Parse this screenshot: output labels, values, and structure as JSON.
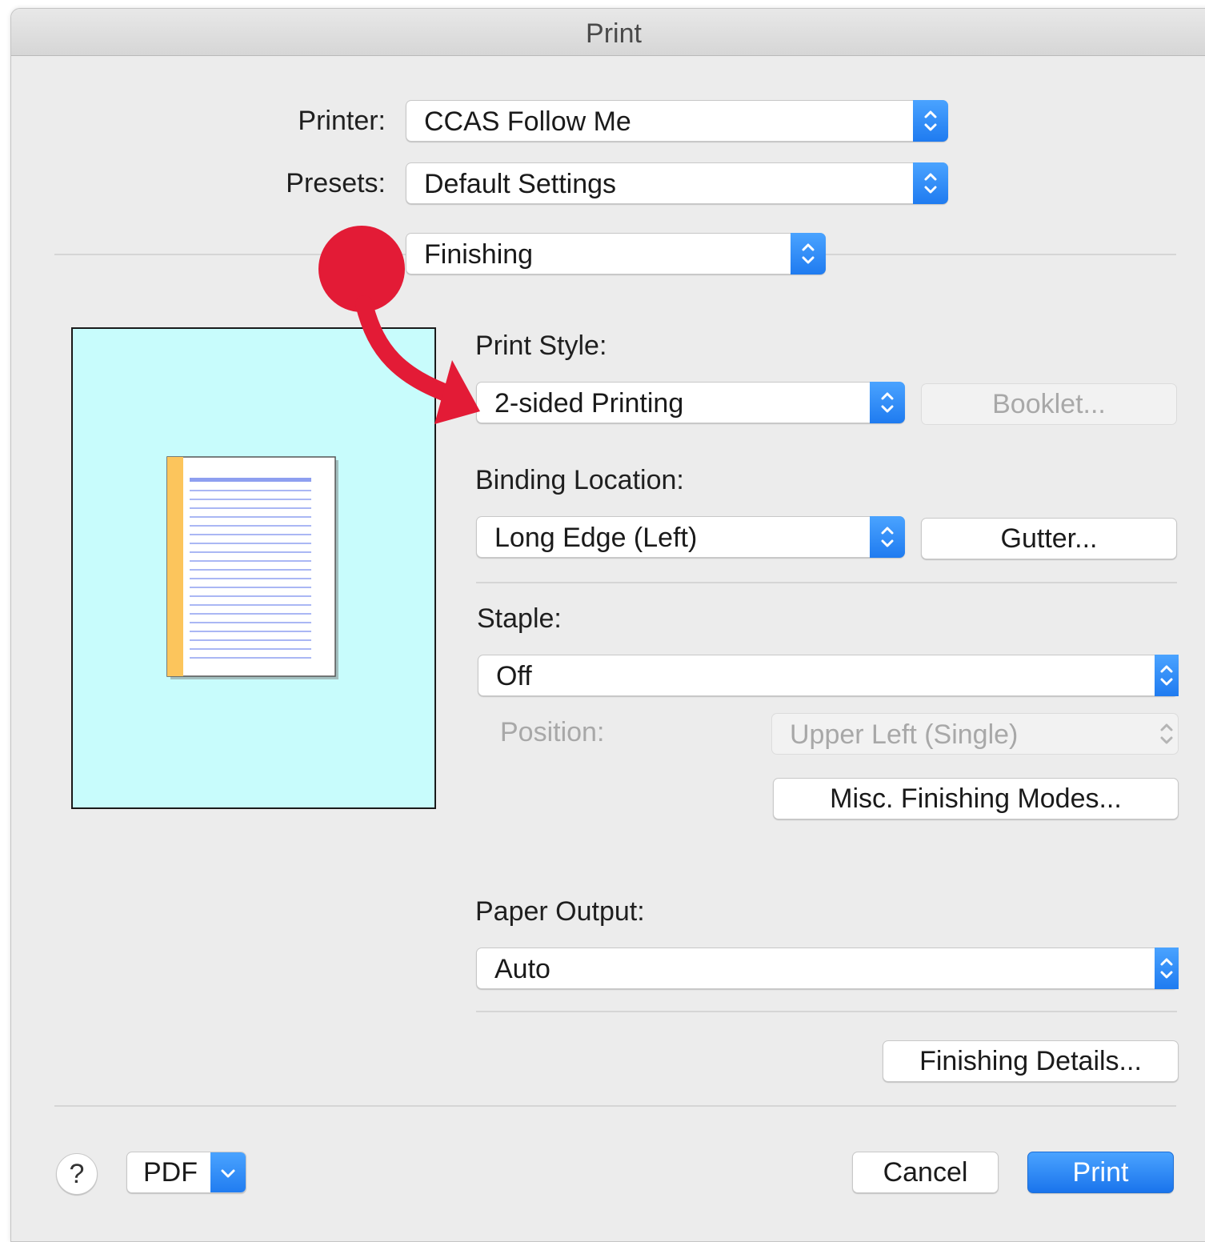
{
  "window": {
    "title": "Print"
  },
  "printer": {
    "label": "Printer:",
    "value": "CCAS Follow Me"
  },
  "presets": {
    "label": "Presets:",
    "value": "Default Settings"
  },
  "panel": {
    "value": "Finishing"
  },
  "print_style": {
    "label": "Print Style:",
    "value": "2-sided Printing",
    "booklet_button": "Booklet..."
  },
  "binding": {
    "label": "Binding Location:",
    "value": "Long Edge (Left)",
    "gutter_button": "Gutter..."
  },
  "staple": {
    "label": "Staple:",
    "value": "Off",
    "position_label": "Position:",
    "position_value": "Upper Left (Single)",
    "misc_button": "Misc. Finishing Modes..."
  },
  "paper_output": {
    "label": "Paper Output:",
    "value": "Auto"
  },
  "finishing_details_button": "Finishing Details...",
  "footer": {
    "help": "?",
    "pdf": "PDF",
    "cancel": "Cancel",
    "print": "Print"
  },
  "colors": {
    "accent": "#1f7bf0",
    "preview_bg": "#c8fcfc",
    "annotation_red": "#e31b36",
    "binding_edge": "#fcc55c",
    "text_lines": "#8e9ff0"
  },
  "icons": {
    "stepper": "up-down-chevron-icon",
    "dropdown": "chevron-down-icon",
    "annotation": "curved-arrow-pointer"
  }
}
